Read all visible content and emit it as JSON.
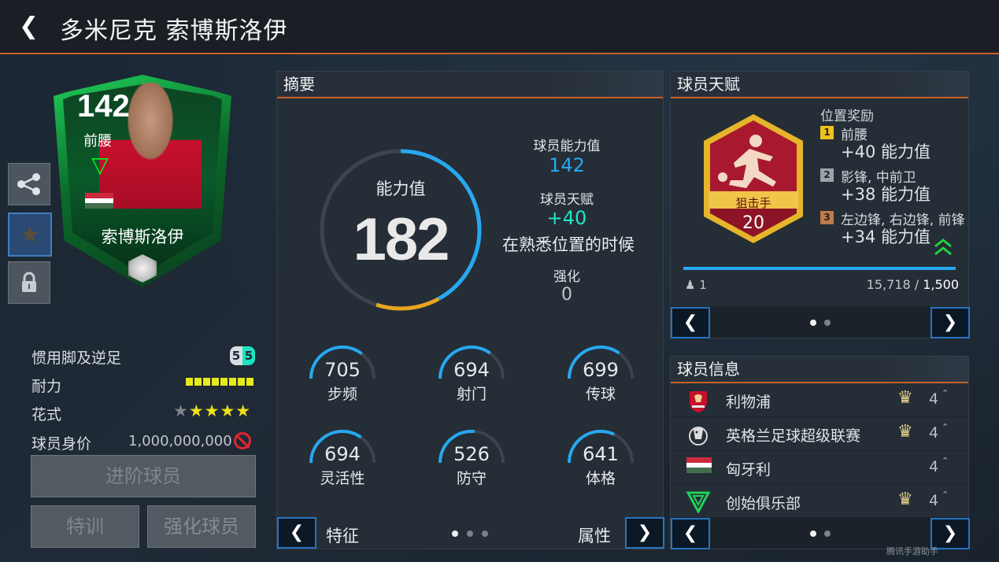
{
  "header": {
    "back_icon": "chevron-left-icon",
    "title": "多米尼克 索博斯洛伊"
  },
  "card": {
    "rating": "142",
    "position": "前腰",
    "name": "索博斯洛伊",
    "flag_colors": [
      "#cd2a3e",
      "#ffffff",
      "#436f4d"
    ]
  },
  "side_buttons": [
    "share-icon",
    "star-icon",
    "lock-icon"
  ],
  "left_stats": {
    "foot_label": "惯用脚及逆足",
    "foot_values": [
      "5",
      "5"
    ],
    "stamina_label": "耐力",
    "skill_label": "花式",
    "skill_stars": 4,
    "skill_stars_total": 5,
    "value_label": "球员身价",
    "value": "1,000,000,000"
  },
  "buttons": {
    "advance": "进阶球员",
    "train": "特训",
    "enhance": "强化球员"
  },
  "summary": {
    "title": "摘要",
    "ovr_label": "能力值",
    "ovr_value": "182",
    "player_ovr_label": "球员能力值",
    "player_ovr": "142",
    "talent_label": "球员天赋",
    "talent_bonus": "+40",
    "talent_note": "在熟悉位置的时候",
    "enhance_label": "强化",
    "enhance_value": "0",
    "stats": [
      {
        "value": "705",
        "label": "步频",
        "fill": 0.71
      },
      {
        "value": "694",
        "label": "射门",
        "fill": 0.7
      },
      {
        "value": "699",
        "label": "传球",
        "fill": 0.7
      },
      {
        "value": "694",
        "label": "灵活性",
        "fill": 0.7
      },
      {
        "value": "526",
        "label": "防守",
        "fill": 0.53
      },
      {
        "value": "641",
        "label": "体格",
        "fill": 0.64
      }
    ],
    "nav_left": "特征",
    "nav_right": "属性"
  },
  "talent": {
    "title": "球员天赋",
    "badge_name": "狙击手",
    "badge_level": "20",
    "bonus_title": "位置奖励",
    "bonuses": [
      {
        "rank": "1",
        "positions": "前腰",
        "value": "+40 能力值",
        "color": "#f0c21a"
      },
      {
        "rank": "2",
        "positions": "影锋, 中前卫",
        "value": "+38 能力值",
        "color": "#9aa3ab"
      },
      {
        "rank": "3",
        "positions": "左边锋, 右边锋, 前锋",
        "value": "+34 能力值",
        "color": "#c07a48"
      }
    ],
    "progress_count": "1",
    "progress_current": "15,718",
    "progress_sep": " / ",
    "progress_target": "1,500"
  },
  "player_info": {
    "title": "球员信息",
    "rows": [
      {
        "icon": "liverpool-crest-icon",
        "text": "利物浦",
        "crown": true,
        "num": "4"
      },
      {
        "icon": "premier-league-icon",
        "text": "英格兰足球超级联赛",
        "crown": true,
        "num": "4"
      },
      {
        "icon": "hungary-flag-icon",
        "text": "匈牙利",
        "crown": false,
        "num": "4"
      },
      {
        "icon": "founders-club-icon",
        "text": "创始俱乐部",
        "crown": true,
        "num": "4"
      }
    ]
  },
  "watermark": "腾讯手游助手"
}
